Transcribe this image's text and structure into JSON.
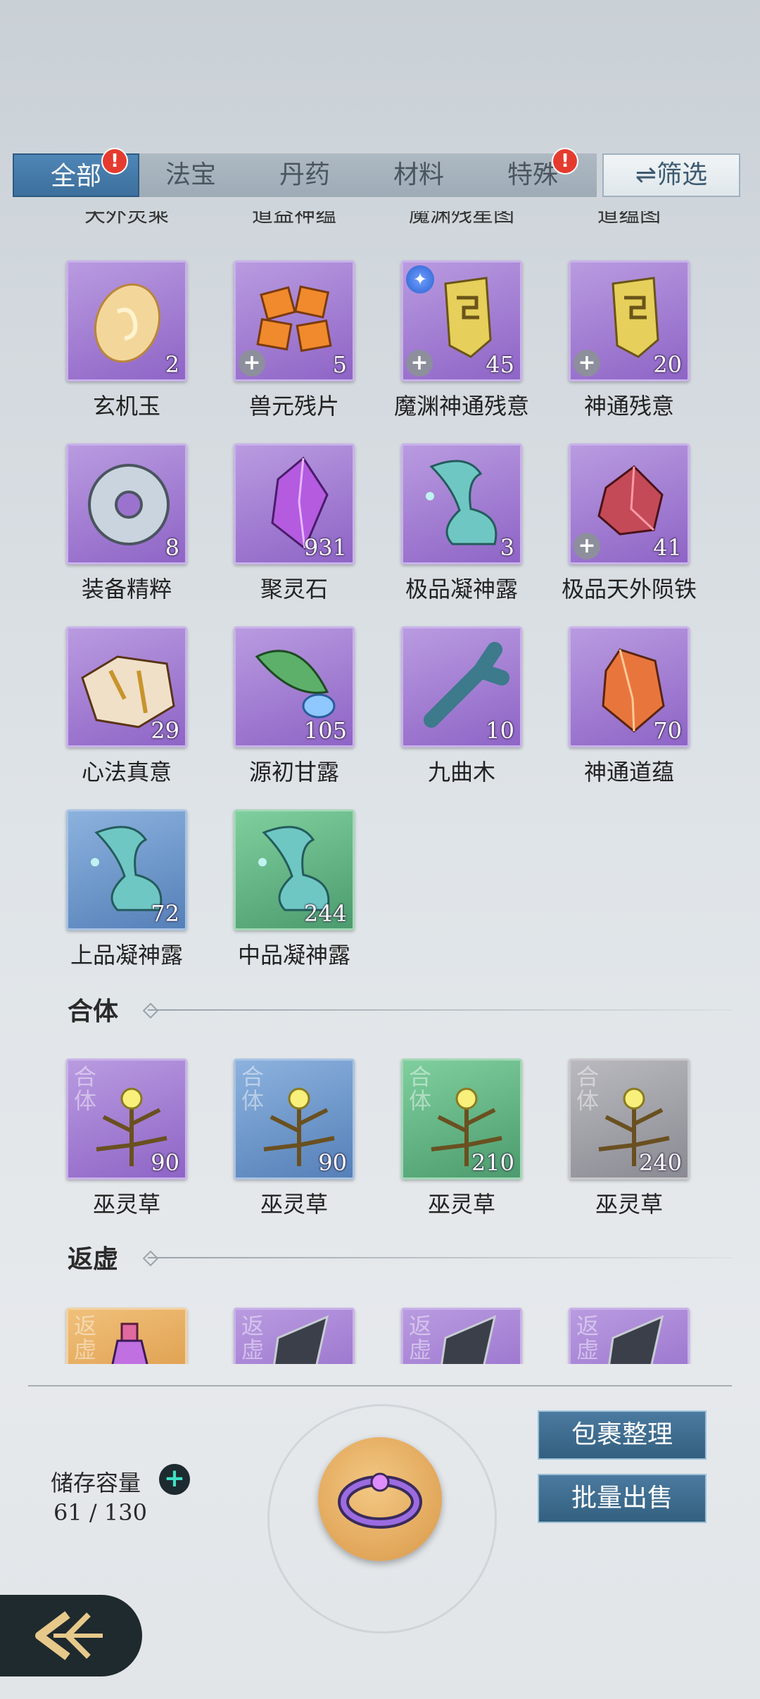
{
  "tabs": {
    "items": [
      {
        "label": "全部",
        "active": true,
        "badge": "!"
      },
      {
        "label": "法宝",
        "active": false
      },
      {
        "label": "丹药",
        "active": false
      },
      {
        "label": "材料",
        "active": false
      },
      {
        "label": "特殊",
        "active": false,
        "badge": "!"
      }
    ],
    "filter_label": "⇌筛选"
  },
  "cut_off_labels": [
    "天外灵乘",
    "道益神蕴",
    "魔渊残星图",
    "道蕴图"
  ],
  "items": [
    {
      "name": "玄机玉",
      "count": "2",
      "rarity": "purple",
      "icon": "jade-disc-icon"
    },
    {
      "name": "兽元残片",
      "count": "5",
      "rarity": "purple",
      "icon": "beast-fragments-icon",
      "plus": true
    },
    {
      "name": "魔渊神通残意",
      "count": "45",
      "rarity": "purple",
      "icon": "scroll-fragment-icon",
      "plus": true,
      "special": true
    },
    {
      "name": "神通残意",
      "count": "20",
      "rarity": "purple",
      "icon": "scroll-fragment-icon",
      "plus": true
    },
    {
      "name": "装备精粹",
      "count": "8",
      "rarity": "purple",
      "icon": "ring-essence-icon"
    },
    {
      "name": "聚灵石",
      "count": "931",
      "rarity": "purple",
      "icon": "spirit-crystal-icon"
    },
    {
      "name": "极品凝神露",
      "count": "3",
      "rarity": "purple",
      "icon": "dew-vase-icon"
    },
    {
      "name": "极品天外陨铁",
      "count": "41",
      "rarity": "purple",
      "icon": "meteor-iron-icon",
      "plus": true
    },
    {
      "name": "心法真意",
      "count": "29",
      "rarity": "purple",
      "icon": "broken-relic-icon"
    },
    {
      "name": "源初甘露",
      "count": "105",
      "rarity": "purple",
      "icon": "leaf-dew-icon"
    },
    {
      "name": "九曲木",
      "count": "10",
      "rarity": "purple",
      "icon": "wood-branch-icon"
    },
    {
      "name": "神通道蕴",
      "count": "70",
      "rarity": "purple",
      "icon": "amber-crystal-icon"
    },
    {
      "name": "上品凝神露",
      "count": "72",
      "rarity": "blue",
      "icon": "dew-vase-icon"
    },
    {
      "name": "中品凝神露",
      "count": "244",
      "rarity": "green",
      "icon": "dew-vase-icon"
    }
  ],
  "sections": [
    {
      "title": "合体",
      "realm_mark": "合体",
      "items": [
        {
          "name": "巫灵草",
          "count": "90",
          "rarity": "purple",
          "icon": "spirit-herb-icon"
        },
        {
          "name": "巫灵草",
          "count": "90",
          "rarity": "blue",
          "icon": "spirit-herb-icon"
        },
        {
          "name": "巫灵草",
          "count": "210",
          "rarity": "green",
          "icon": "spirit-herb-icon"
        },
        {
          "name": "巫灵草",
          "count": "240",
          "rarity": "grey",
          "icon": "spirit-herb-icon"
        }
      ]
    },
    {
      "title": "返虚",
      "realm_mark": "返虚",
      "items": [
        {
          "rarity": "orange",
          "icon": "potion-bottle-icon"
        },
        {
          "rarity": "purple",
          "icon": "dark-shard-icon"
        },
        {
          "rarity": "purple",
          "icon": "dark-shard-icon"
        },
        {
          "rarity": "purple",
          "icon": "dark-shard-icon"
        }
      ]
    }
  ],
  "footer": {
    "storage_label": "储存容量",
    "storage_value": "61 / 130",
    "sort_label": "包裹整理",
    "sell_label": "批量出售",
    "center_icon": "storage-ring-icon",
    "back_icon": "back-arrow-icon"
  },
  "colors": {
    "active_tab": "#3c6f9c",
    "purple_tile": "#8e64c6",
    "blue_tile": "#5580b8",
    "green_tile": "#4c9b6e",
    "grey_tile": "#8a8a92",
    "orange_tile": "#d7913c"
  }
}
